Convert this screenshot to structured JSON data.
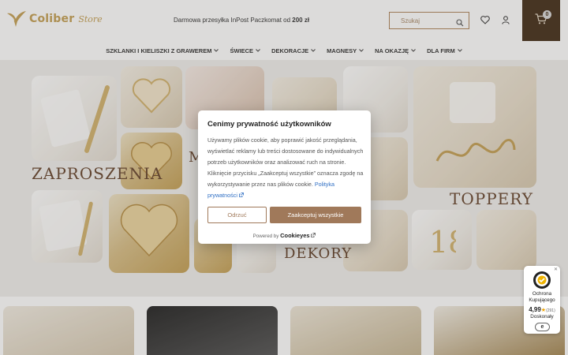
{
  "header": {
    "brand": "Coliber",
    "brand_sub": "Store",
    "shipping_prefix": "Darmowa przesyłka InPost Paczkomat od ",
    "shipping_amount": "200 zł",
    "search_placeholder": "Szukaj",
    "cart_count": "0",
    "brand_color": "#c6a35a",
    "cart_bg": "#4a3520"
  },
  "nav": {
    "items": [
      {
        "label": "SZKLANKI I KIELISZKI Z GRAWEREM"
      },
      {
        "label": "ŚWIECE"
      },
      {
        "label": "DEKORACJE"
      },
      {
        "label": "MAGNESY"
      },
      {
        "label": "NA OKAZJĘ"
      },
      {
        "label": "DLA FIRM"
      }
    ]
  },
  "hero": {
    "labels": {
      "zaproszenia": "ZAPROSZENIA",
      "toppery": "TOPPERY",
      "dekory": "DEKORY",
      "m": "M"
    }
  },
  "cookie": {
    "title": "Cenimy prywatność użytkowników",
    "body": "Używamy plików cookie, aby poprawić jakość przeglądania, wyświetlać reklamy lub treści dostosowane do indywidualnych potrzeb użytkowników oraz analizować ruch na stronie. Kliknięcie przycisku „Zaakceptuj wszystkie” oznacza zgodę na wykorzystywanie przez nas plików cookie.",
    "policy_link": "Polityka prywatności",
    "reject_label": "Odrzuć",
    "accept_label": "Zaakceptuj wszystkie",
    "powered_by": "Powered by",
    "powered_brand": "Cookieyes",
    "accent_color": "#a0795a"
  },
  "trust_badge": {
    "line1": "Ochrona",
    "line2": "Kupującego",
    "score": "4,99",
    "count": "(291)",
    "rating_text": "Doskonały",
    "mark": "e"
  }
}
